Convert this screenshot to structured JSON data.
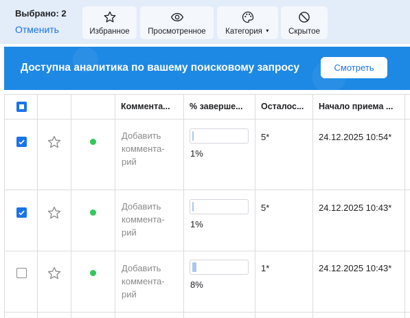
{
  "selection": {
    "count_label": "Выбрано: 2",
    "cancel_label": "Отменить"
  },
  "toolbar": {
    "favorites": "Избранное",
    "viewed": "Просмотренное",
    "category": "Категория",
    "hidden": "Скрытое"
  },
  "banner": {
    "text": "Доступна аналитика по вашему поисковому запросу",
    "button": "Смотреть"
  },
  "table": {
    "columns": [
      "Коммента...",
      "% заверше...",
      "Осталос...",
      "Начало приема ..."
    ],
    "rows": [
      {
        "checked": true,
        "status": "active",
        "comment": [
          "Добавить",
          "коммента-",
          "рий"
        ],
        "progress_pct": 1,
        "progress_label": "1%",
        "remaining": "5*",
        "start": "24.12.2025 10:54*"
      },
      {
        "checked": true,
        "status": "active",
        "comment": [
          "Добавить",
          "коммента-",
          "рий"
        ],
        "progress_pct": 1,
        "progress_label": "1%",
        "remaining": "5*",
        "start": "24.12.2025 10:43*"
      },
      {
        "checked": false,
        "status": "active",
        "comment": [
          "Добавить",
          "коммента-",
          "рий"
        ],
        "progress_pct": 8,
        "progress_label": "8%",
        "remaining": "1*",
        "start": "24.12.2025 10:43*"
      }
    ]
  },
  "colors": {
    "accent": "#1a73e8",
    "banner": "#1e88e5",
    "status_active": "#34c759",
    "toolbar_bg": "#e3ecf9"
  }
}
